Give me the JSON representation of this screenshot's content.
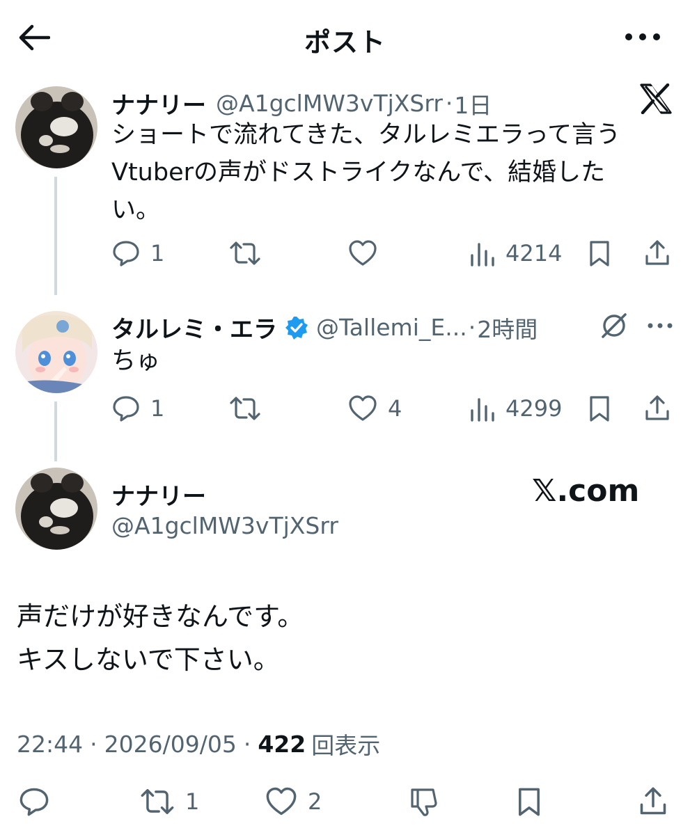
{
  "header": {
    "title": "ポスト",
    "back_icon": "arrow-left-icon",
    "more_icon": "more-horizontal-icon"
  },
  "tweets": [
    {
      "name": "ナナリー",
      "handle": "@A1gclMW3vTjXSrr",
      "dot": "·",
      "time": "1日",
      "text_lines": [
        "ショートで流れてきた、タルレミエラって言う",
        "Vtuberの声がドストライクなんで、結婚した",
        "い。"
      ],
      "replies": "1",
      "retweets": "",
      "likes": "",
      "views": "4214",
      "badge_icon": "x-logo-icon"
    },
    {
      "name": "タルレミ・エラ",
      "verified": true,
      "handle": "@Tallemi_E...",
      "dot": "·",
      "time": "2時間",
      "text_lines": [
        "ちゅ"
      ],
      "replies": "1",
      "retweets": "",
      "likes": "4",
      "views": "4299",
      "badge_icon": "grok-icon"
    }
  ],
  "main": {
    "name": "ナナリー",
    "handle": "@A1gclMW3vTjXSrr",
    "watermark": "𝕏.com",
    "text_lines": [
      "声だけが好きなんです。",
      "キスしないで下さい。"
    ],
    "time": "22:44",
    "date": "2026/09/05",
    "sep": "·",
    "views": "422",
    "views_label": "回表示",
    "retweets": "1",
    "likes": "2"
  },
  "colors": {
    "text": "#0f1419",
    "secondary": "#536471",
    "verified": "#1d9bf0",
    "thread_line": "#cfd9de"
  }
}
